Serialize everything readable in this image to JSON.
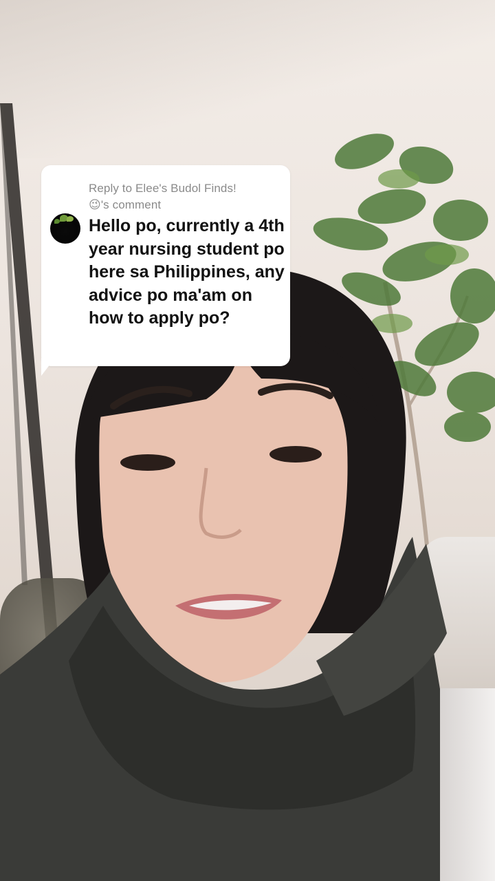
{
  "reply": {
    "header_line1": "Reply to Elee's Budol Finds!",
    "header_line2": "😉's comment",
    "comment": "Hello po, currently a 4th year nursing student po here sa Philippines, any advice po ma'am on how to apply po?"
  },
  "icons": {
    "avatar": "avatar-image"
  }
}
